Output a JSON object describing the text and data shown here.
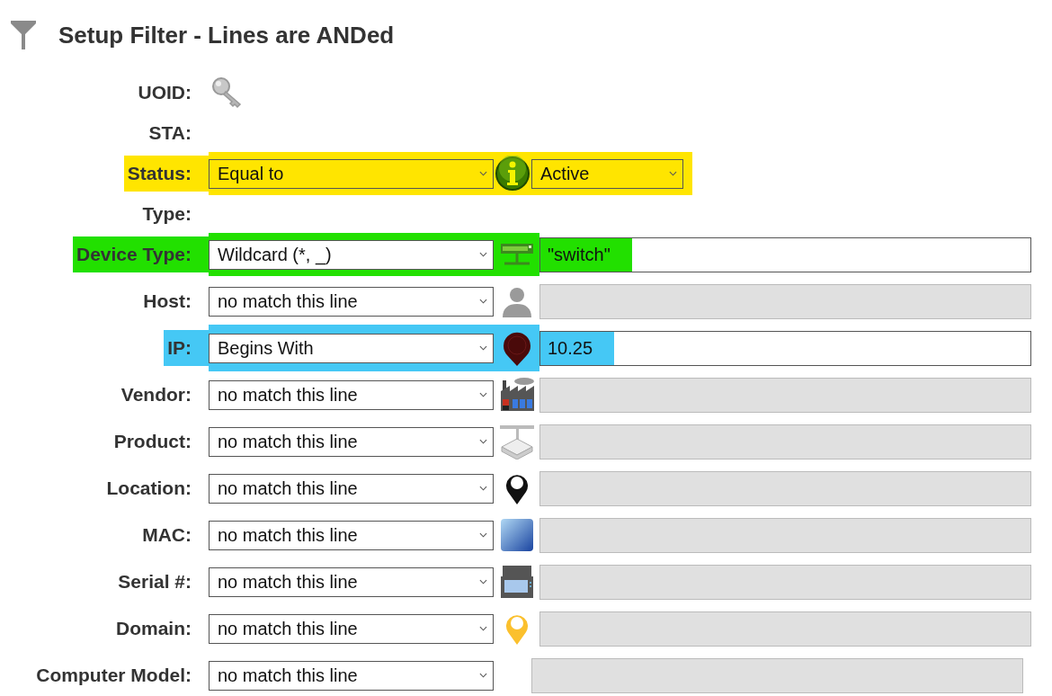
{
  "title": "Setup Filter - Lines are ANDed",
  "rows": [
    {
      "kind": "icon",
      "label": "UOID:"
    },
    {
      "kind": "plain",
      "label": "STA:"
    },
    {
      "kind": "choice",
      "label": "Status:",
      "operator": "Equal to",
      "value": "Active",
      "color": "#ffe500"
    },
    {
      "kind": "plain",
      "label": "Type:"
    },
    {
      "kind": "text",
      "label": "Device Type:",
      "operator": "Wildcard (*, _)",
      "value": "\"switch\"",
      "disabled": false,
      "color": "#22e000"
    },
    {
      "kind": "text",
      "label": "Host:",
      "operator": "no match this line",
      "disabled": true
    },
    {
      "kind": "text",
      "label": "IP:",
      "operator": "Begins With",
      "value": "10.25",
      "disabled": false,
      "color": "#45c8f5"
    },
    {
      "kind": "text",
      "label": "Vendor:",
      "operator": "no match this line",
      "disabled": true
    },
    {
      "kind": "text",
      "label": "Product:",
      "operator": "no match this line",
      "disabled": true
    },
    {
      "kind": "text",
      "label": "Location:",
      "operator": "no match this line",
      "disabled": true
    },
    {
      "kind": "text",
      "label": "MAC:",
      "operator": "no match this line",
      "disabled": true
    },
    {
      "kind": "text",
      "label": "Serial #:",
      "operator": "no match this line",
      "disabled": true
    },
    {
      "kind": "text",
      "label": "Domain:",
      "operator": "no match this line",
      "disabled": true
    },
    {
      "kind": "text",
      "label": "Computer Model:",
      "operator": "no match this line",
      "disabled": true
    }
  ]
}
